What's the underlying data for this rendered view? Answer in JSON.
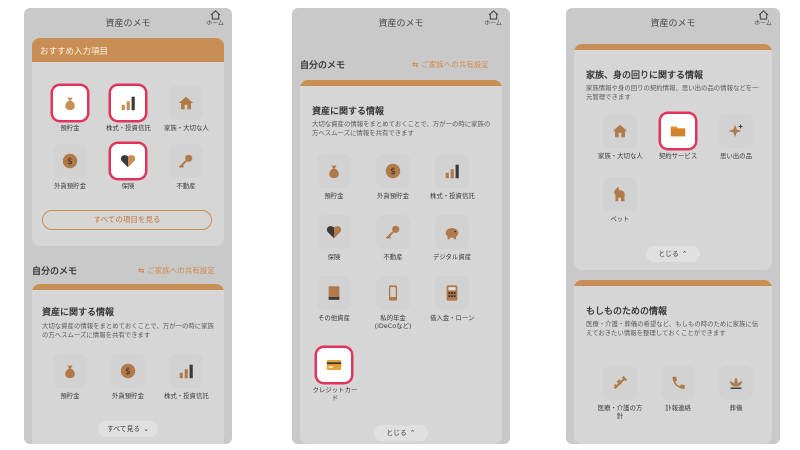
{
  "app": {
    "title": "資産のメモ",
    "home_label": "ホーム"
  },
  "colors": {
    "accent": "#c98e54",
    "highlight": "#e2345a"
  },
  "screen1": {
    "recommended": {
      "title": "おすすめ入力項目",
      "items": [
        {
          "label": "預貯金",
          "icon": "money-bag-icon"
        },
        {
          "label": "株式・投資信託",
          "icon": "bar-chart-icon"
        },
        {
          "label": "家族・大切な人",
          "icon": "house-icon"
        },
        {
          "label": "外貨預貯金",
          "icon": "coin-icon"
        },
        {
          "label": "保険",
          "icon": "heart-icon"
        },
        {
          "label": "不動産",
          "icon": "key-icon"
        }
      ],
      "view_all": "すべての項目を見る"
    },
    "my_memo": {
      "title": "自分のメモ",
      "share": "ご家族への共有設定"
    },
    "assets": {
      "title": "資産に関する情報",
      "desc": "大切な資産の情報をまとめておくことで、万が一の時に家族の方へスムーズに情報を共有できます",
      "items": [
        {
          "label": "預貯金",
          "icon": "money-bag-icon"
        },
        {
          "label": "外貨預貯金",
          "icon": "coin-icon"
        },
        {
          "label": "株式・投資信託",
          "icon": "bar-chart-icon"
        }
      ],
      "show_all": "すべて見る"
    }
  },
  "screen2": {
    "my_memo": {
      "title": "自分のメモ",
      "share": "ご家族への共有設定"
    },
    "assets": {
      "title": "資産に関する情報",
      "desc": "大切な資産の情報をまとめておくことで、万が一の時に家族の方へスムーズに情報を共有できます",
      "items": [
        {
          "label": "預貯金",
          "icon": "money-bag-icon"
        },
        {
          "label": "外貨預貯金",
          "icon": "coin-icon"
        },
        {
          "label": "株式・投資信託",
          "icon": "bar-chart-icon"
        },
        {
          "label": "保険",
          "icon": "heart-icon"
        },
        {
          "label": "不動産",
          "icon": "key-icon"
        },
        {
          "label": "デジタル資産",
          "icon": "piggy-bank-icon"
        },
        {
          "label": "その他資産",
          "icon": "book-icon"
        },
        {
          "label": "私的年金\n(iDeCoなど)",
          "icon": "smartphone-icon"
        },
        {
          "label": "借入金・ローン",
          "icon": "calculator-icon"
        },
        {
          "label": "クレジットカード",
          "icon": "credit-card-icon"
        }
      ],
      "close": "とじる"
    }
  },
  "screen3": {
    "family": {
      "title": "家族、身の回りに関する情報",
      "desc": "家族情報や身の回りの契約情報、思い出の品の情報などを一元管理できます",
      "items": [
        {
          "label": "家族・大切な人",
          "icon": "house-icon"
        },
        {
          "label": "契約サービス",
          "icon": "folder-icon"
        },
        {
          "label": "思い出の品",
          "icon": "sparkle-icon"
        },
        {
          "label": "ペット",
          "icon": "pet-icon"
        }
      ],
      "close": "とじる"
    },
    "emergency": {
      "title": "もしものための情報",
      "desc": "医療・介護・葬儀の希望など、もしもの時のために家族に伝えておきたい情報を整理しておくことができます",
      "items": [
        {
          "label": "医療・介護の方針",
          "icon": "syringe-icon"
        },
        {
          "label": "訃報連絡",
          "icon": "phone-icon"
        },
        {
          "label": "葬儀",
          "icon": "lotus-icon"
        }
      ]
    }
  }
}
